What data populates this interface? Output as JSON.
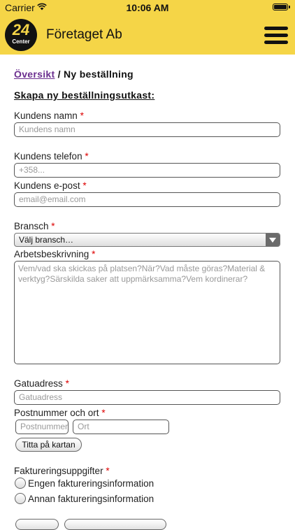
{
  "status_bar": {
    "carrier": "Carrier",
    "time": "10:06 AM"
  },
  "header": {
    "logo_number": "24",
    "logo_word": "Center",
    "company": "Företaget Ab"
  },
  "breadcrumb": {
    "link": "Översikt",
    "current": "/ Ny beställning"
  },
  "form": {
    "title": "Skapa ny beställningsutkast:",
    "name": {
      "label": "Kundens namn",
      "placeholder": "Kundens namn"
    },
    "phone": {
      "label": "Kundens telefon",
      "placeholder": "+358..."
    },
    "email": {
      "label": "Kundens e-post",
      "placeholder": "email@email.com"
    },
    "industry": {
      "label": "Bransch",
      "selected": "Välj bransch…"
    },
    "work": {
      "label": "Arbetsbeskrivning",
      "placeholder": "Vem/vad ska skickas på platsen?När?Vad måste göras?Material & verktyg?Särskilda saker att uppmärksamma?Vem kordinerar?"
    },
    "street": {
      "label": "Gatuadress",
      "placeholder": "Gatuadress"
    },
    "postal": {
      "label": "Postnummer och ort",
      "postal_placeholder": "Postnummer",
      "city_placeholder": "Ort"
    },
    "map_button": "Titta på kartan",
    "billing": {
      "label": "Faktureringsuppgifter",
      "options": [
        "Engen faktureringsinformation",
        "Annan faktureringsinformation"
      ]
    },
    "required_mark": "*"
  }
}
